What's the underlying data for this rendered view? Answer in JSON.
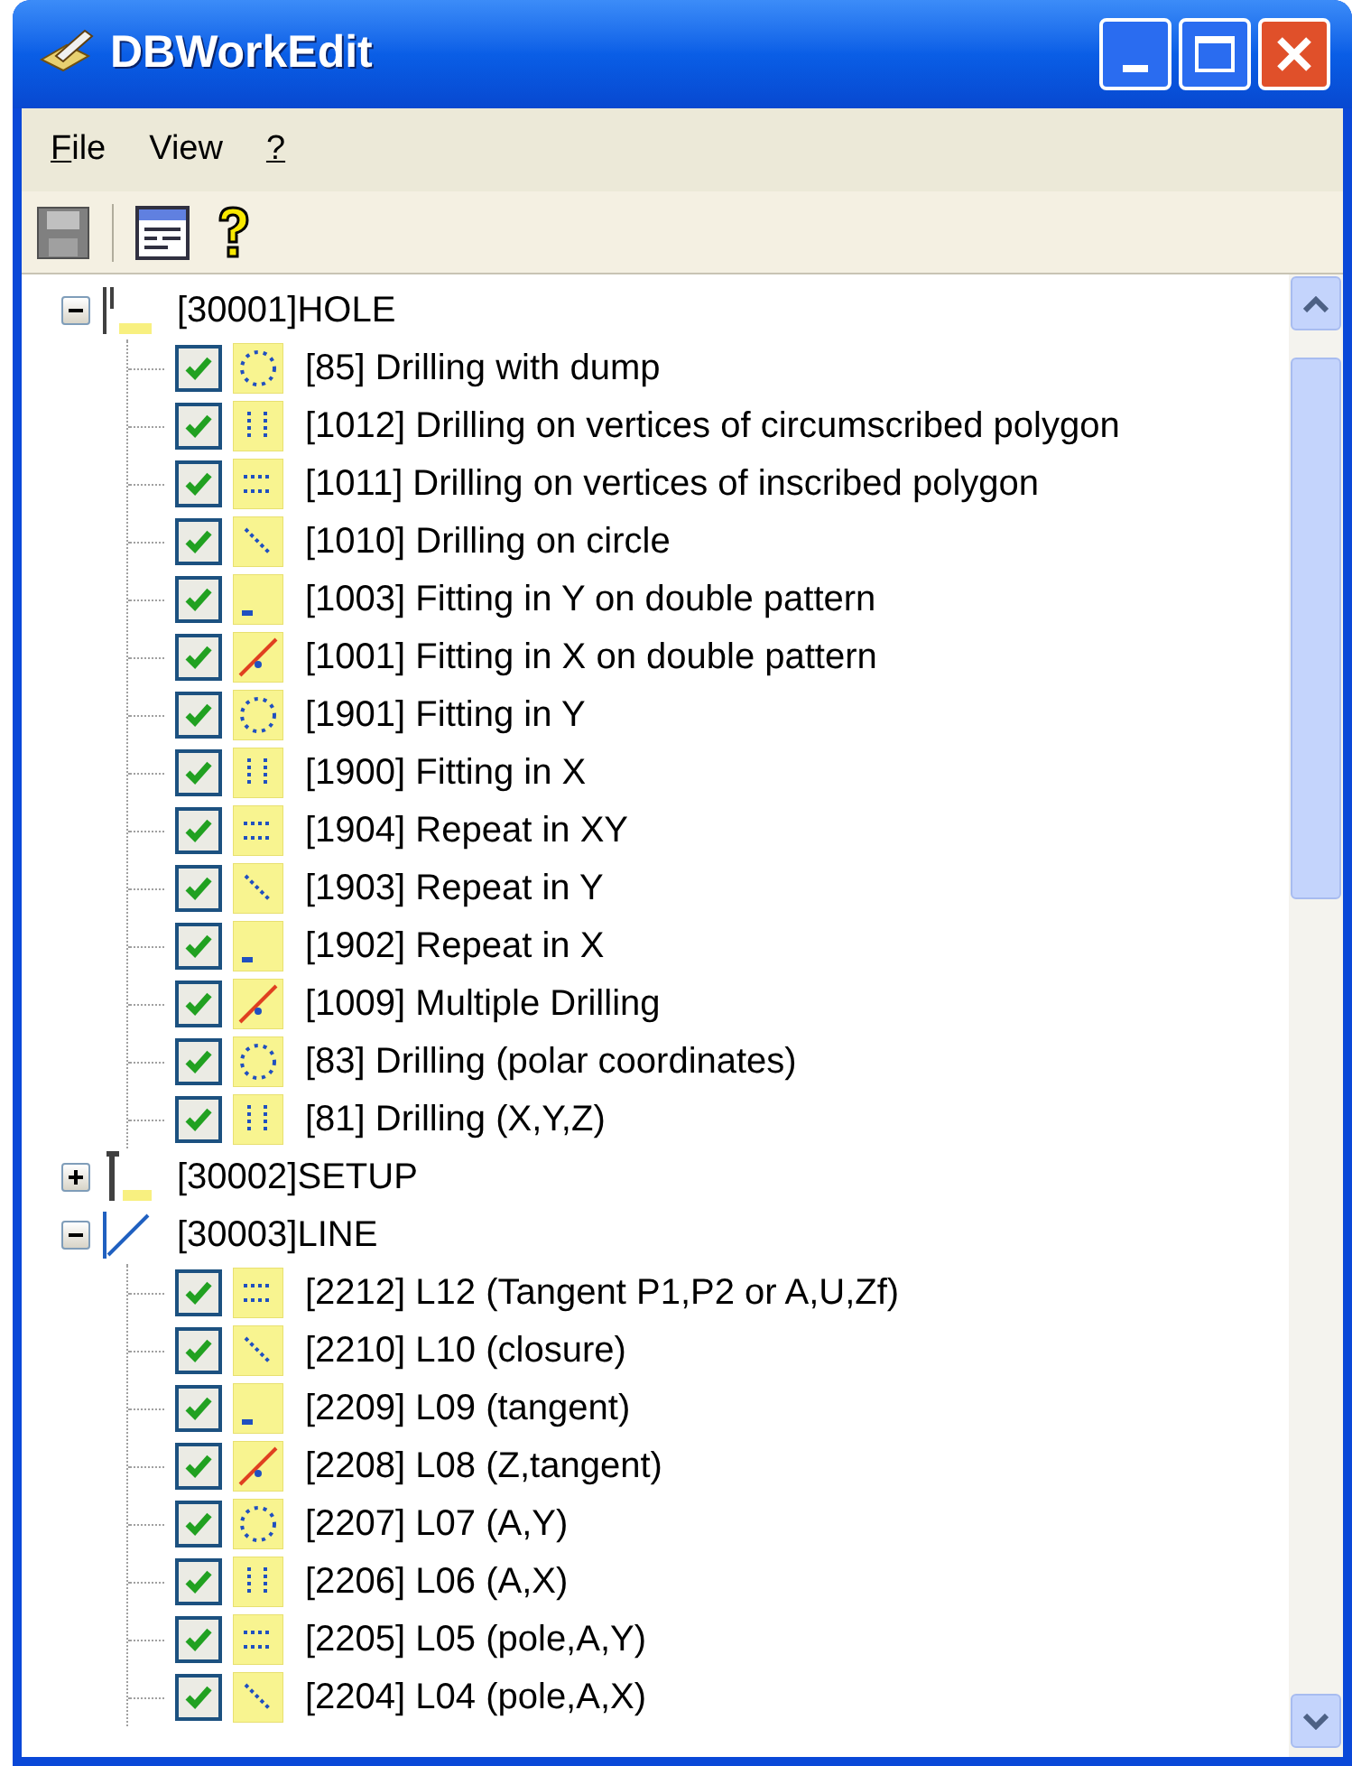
{
  "window": {
    "title": "DBWorkEdit"
  },
  "menu": [
    {
      "label": "File",
      "mnemonic_underlined": true
    },
    {
      "label": "View",
      "mnemonic_underlined": false
    },
    {
      "label": "?",
      "mnemonic_underlined": true
    }
  ],
  "tree": [
    {
      "label": "[30001]HOLE",
      "expanded": true,
      "children": [
        {
          "label": "[85] Drilling with dump",
          "checked": true
        },
        {
          "label": "[1012] Drilling on vertices of circumscribed polygon",
          "checked": true
        },
        {
          "label": "[1011] Drilling on vertices of inscribed polygon",
          "checked": true
        },
        {
          "label": "[1010] Drilling on circle",
          "checked": true
        },
        {
          "label": "[1003] Fitting in Y on double pattern",
          "checked": true
        },
        {
          "label": "[1001] Fitting in X on double pattern",
          "checked": true
        },
        {
          "label": "[1901] Fitting in Y",
          "checked": true
        },
        {
          "label": "[1900] Fitting in X",
          "checked": true
        },
        {
          "label": "[1904] Repeat in XY",
          "checked": true
        },
        {
          "label": "[1903] Repeat in Y",
          "checked": true
        },
        {
          "label": "[1902] Repeat in X",
          "checked": true
        },
        {
          "label": "[1009] Multiple Drilling",
          "checked": true
        },
        {
          "label": "[83] Drilling (polar coordinates)",
          "checked": true
        },
        {
          "label": "[81] Drilling (X,Y,Z)",
          "checked": true
        }
      ]
    },
    {
      "label": "[30002]SETUP",
      "expanded": false
    },
    {
      "label": "[30003]LINE",
      "expanded": true,
      "children": [
        {
          "label": "[2212] L12 (Tangent P1,P2 or A,U,Zf)",
          "checked": true
        },
        {
          "label": "[2210] L10 (closure)",
          "checked": true
        },
        {
          "label": "[2209] L09 (tangent)",
          "checked": true
        },
        {
          "label": "[2208] L08 (Z,tangent)",
          "checked": true
        },
        {
          "label": "[2207] L07 (A,Y)",
          "checked": true
        },
        {
          "label": "[2206] L06 (A,X)",
          "checked": true
        },
        {
          "label": "[2205] L05 (pole,A,Y)",
          "checked": true
        },
        {
          "label": "[2204] L04 (pole,A,X)",
          "checked": true
        }
      ]
    }
  ]
}
